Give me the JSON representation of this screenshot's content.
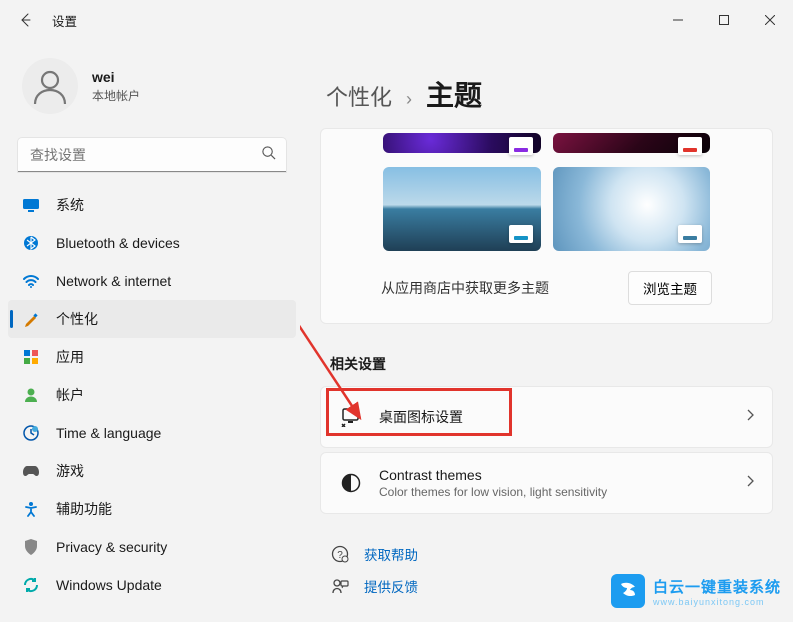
{
  "window": {
    "title": "设置"
  },
  "profile": {
    "name": "wei",
    "subtitle": "本地帐户"
  },
  "search": {
    "placeholder": "查找设置"
  },
  "nav": [
    {
      "label": "系统"
    },
    {
      "label": "Bluetooth & devices"
    },
    {
      "label": "Network & internet"
    },
    {
      "label": "个性化"
    },
    {
      "label": "应用"
    },
    {
      "label": "帐户"
    },
    {
      "label": "Time & language"
    },
    {
      "label": "游戏"
    },
    {
      "label": "辅助功能"
    },
    {
      "label": "Privacy & security"
    },
    {
      "label": "Windows Update"
    }
  ],
  "breadcrumb": {
    "parent": "个性化",
    "current": "主题"
  },
  "themes": {
    "store_text": "从应用商店中获取更多主题",
    "browse_button": "浏览主题",
    "accent_colors": [
      "#8a2be2",
      "#e1342c",
      "#1593c6",
      "#3a7da1"
    ]
  },
  "related": {
    "title": "相关设置",
    "desktop_icons": {
      "title": "桌面图标设置"
    },
    "contrast": {
      "title": "Contrast themes",
      "subtitle": "Color themes for low vision, light sensitivity"
    }
  },
  "links": {
    "help": "获取帮助",
    "feedback": "提供反馈"
  },
  "watermark": {
    "line1": "白云一键重装系统",
    "line2": "www.baiyunxitong.com"
  }
}
